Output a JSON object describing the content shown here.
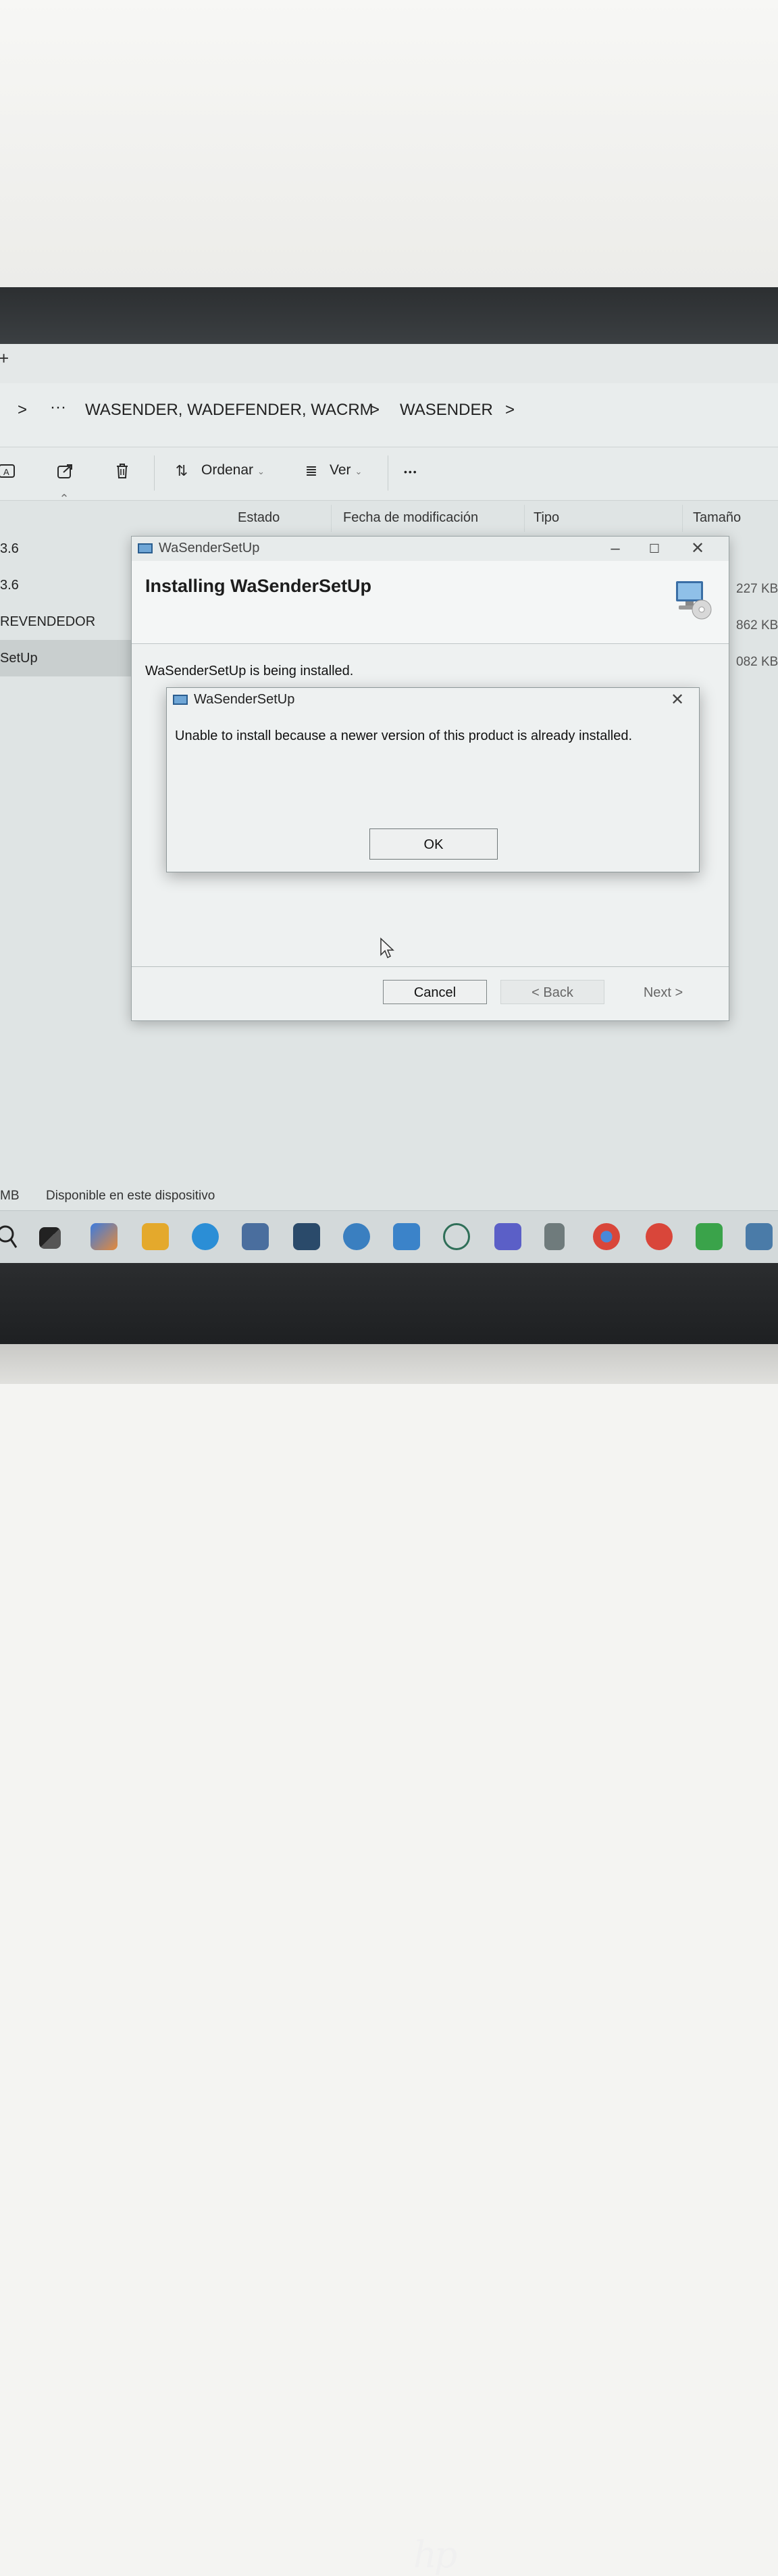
{
  "breadcrumb": {
    "separator": ">",
    "ellipsis": "···",
    "folder1": "WASENDER, WADEFENDER, WACRM",
    "folder2": "WASENDER"
  },
  "toolbar": {
    "sort_label": "Ordenar",
    "view_label": "Ver",
    "more_label": "•••"
  },
  "columns": {
    "status": "Estado",
    "modified": "Fecha de modificación",
    "type": "Tipo",
    "size": "Tamaño"
  },
  "files": [
    {
      "name": "3.6"
    },
    {
      "name": "3.6",
      "size": "227 KB"
    },
    {
      "name": "REVENDEDOR",
      "size": "862 KB"
    },
    {
      "name": "SetUp",
      "size": "082 KB"
    }
  ],
  "installer": {
    "title": "WaSenderSetUp",
    "heading": "Installing WaSenderSetUp",
    "body": "WaSenderSetUp is being installed.",
    "cancel": "Cancel",
    "back": "< Back",
    "next": "Next >"
  },
  "message_box": {
    "title": "WaSenderSetUp",
    "message": "Unable to install because a newer version of this product is already installed.",
    "ok": "OK"
  },
  "statusbar": {
    "size_unit": "MB",
    "availability": "Disponible en este dispositivo"
  },
  "icons": {
    "search": "search-icon",
    "close": "close-icon"
  }
}
